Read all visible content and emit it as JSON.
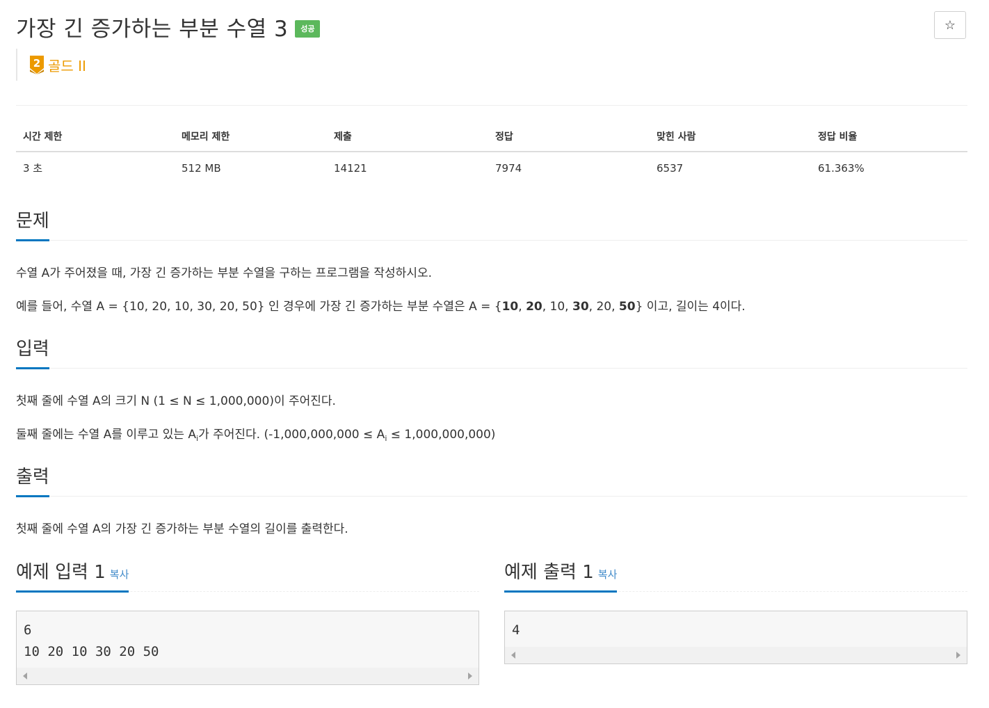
{
  "header": {
    "title": "가장 긴 증가하는 부분 수열 3",
    "result_badge": "성공",
    "star_icon": "☆",
    "tier": {
      "number": "2",
      "label": "골드 II",
      "color": "#ec9a00"
    }
  },
  "info_table": {
    "headers": [
      "시간 제한",
      "메모리 제한",
      "제출",
      "정답",
      "맞힌 사람",
      "정답 비율"
    ],
    "values": [
      "3 초",
      "512 MB",
      "14121",
      "7974",
      "6537",
      "61.363%"
    ]
  },
  "problem": {
    "title": "문제",
    "line1": "수열 A가 주어졌을 때, 가장 긴 증가하는 부분 수열을 구하는 프로그램을 작성하시오.",
    "line2": {
      "prefix": "예를 들어, 수열 A = {10, 20, 10, 30, 20, 50} 인 경우에 가장 긴 증가하는 부분 수열은 A = {",
      "parts": [
        "10",
        ", ",
        "20",
        ", 10, ",
        "30",
        ", 20, ",
        "50"
      ],
      "suffix": "} 이고, 길이는 4이다."
    }
  },
  "input": {
    "title": "입력",
    "line1": "첫째 줄에 수열 A의 크기 N (1 ≤ N ≤ 1,000,000)이 주어진다.",
    "line2_a": "둘째 줄에는 수열 A를 이루고 있는 A",
    "line2_sub": "i",
    "line2_b": "가 주어진다. (-1,000,000,000 ≤ A",
    "line2_sub2": "i",
    "line2_c": " ≤ 1,000,000,000)"
  },
  "output": {
    "title": "출력",
    "line1": "첫째 줄에 수열 A의 가장 긴 증가하는 부분 수열의 길이를 출력한다."
  },
  "examples": {
    "input_title": "예제 입력 1",
    "output_title": "예제 출력 1",
    "copy_label": "복사",
    "input_lines": [
      "6",
      "10 20 10 30 20 50"
    ],
    "output_lines": [
      "4"
    ]
  }
}
